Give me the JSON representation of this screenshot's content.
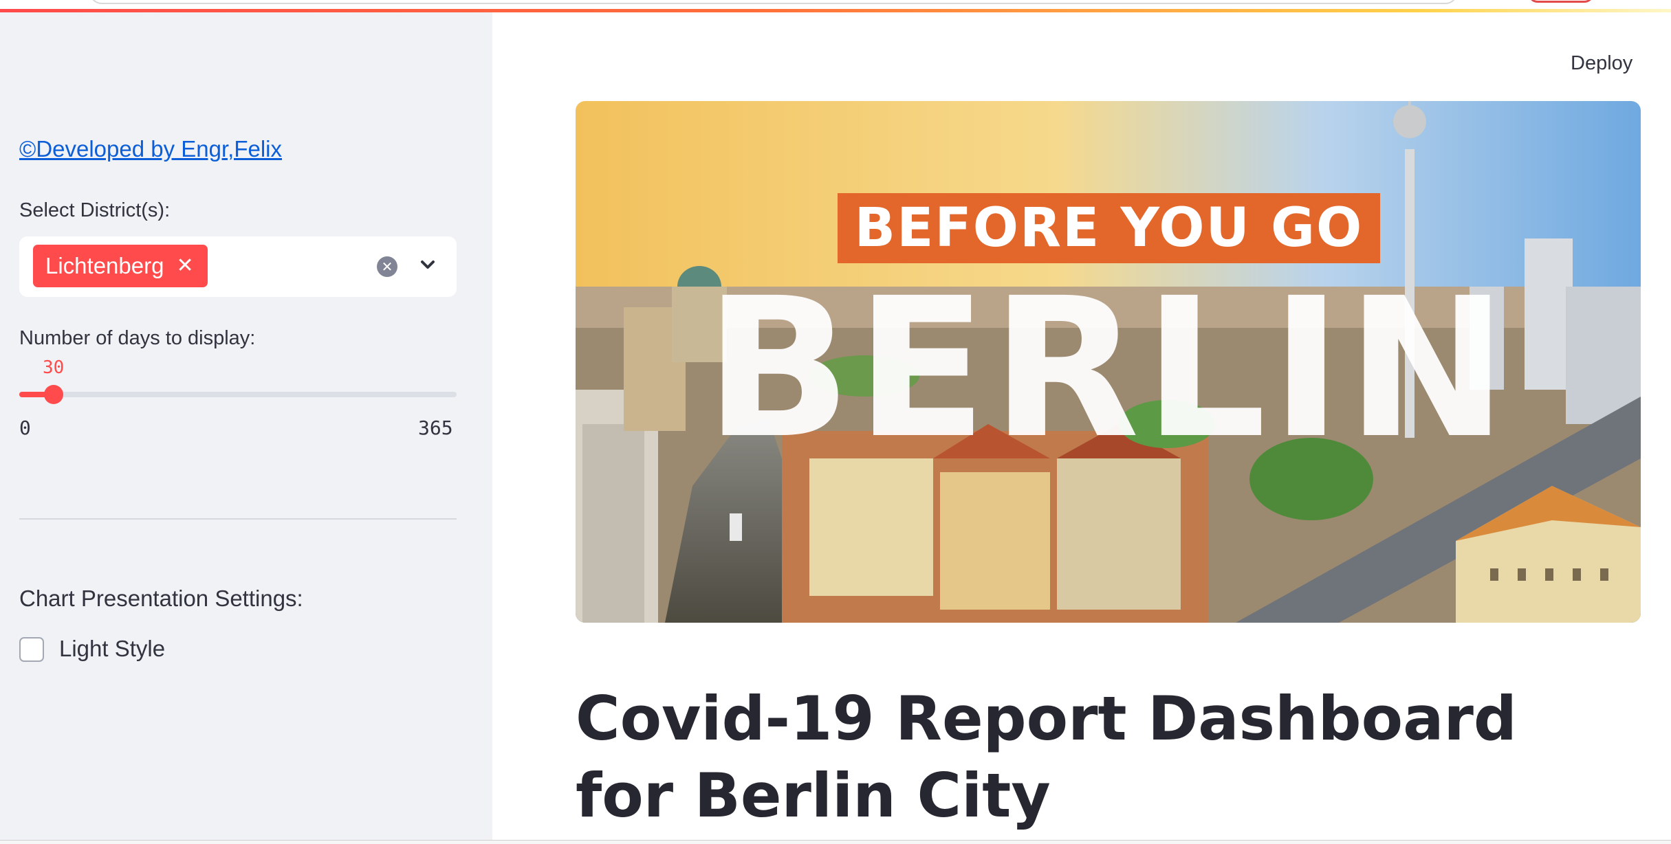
{
  "sidebar": {
    "developer_link": "©Developed by Engr,Felix",
    "district_select": {
      "label": "Select District(s):",
      "selected": [
        "Lichtenberg"
      ]
    },
    "days_slider": {
      "label": "Number of days to display:",
      "value": "30",
      "min": "0",
      "max": "365"
    },
    "chart_settings": {
      "heading": "Chart Presentation Settings:",
      "light_style_label": "Light Style",
      "light_style_checked": false
    }
  },
  "header": {
    "deploy_label": "Deploy"
  },
  "banner": {
    "tag_text": "BEFORE YOU GO",
    "big_text": "BERLIN"
  },
  "main": {
    "title": "Covid-19 Report Dashboard for Berlin City"
  },
  "colors": {
    "accent": "#ff4b4b",
    "sidebar_bg": "#f0f2f6",
    "banner_tag": "#e3662a"
  }
}
